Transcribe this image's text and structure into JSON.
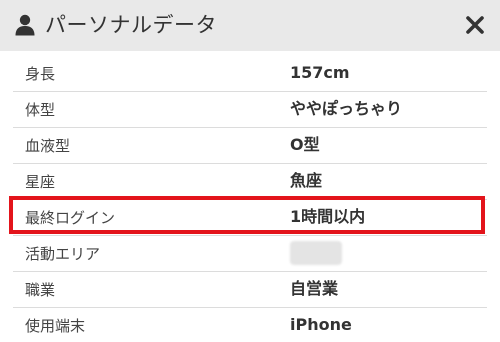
{
  "header": {
    "title": "パーソナルデータ",
    "user_icon": "user-icon",
    "close_icon": "close-icon"
  },
  "rows": [
    {
      "label": "身長",
      "value": "157cm"
    },
    {
      "label": "体型",
      "value": "ややぽっちゃり"
    },
    {
      "label": "血液型",
      "value": "O型"
    },
    {
      "label": "星座",
      "value": "魚座"
    },
    {
      "label": "最終ログイン",
      "value": "1時間以内"
    },
    {
      "label": "活動エリア",
      "value": ""
    },
    {
      "label": "職業",
      "value": "自営業"
    },
    {
      "label": "使用端末",
      "value": "iPhone"
    }
  ],
  "colors": {
    "highlight": "#e3141b",
    "header_bg": "#e9e9e9"
  }
}
